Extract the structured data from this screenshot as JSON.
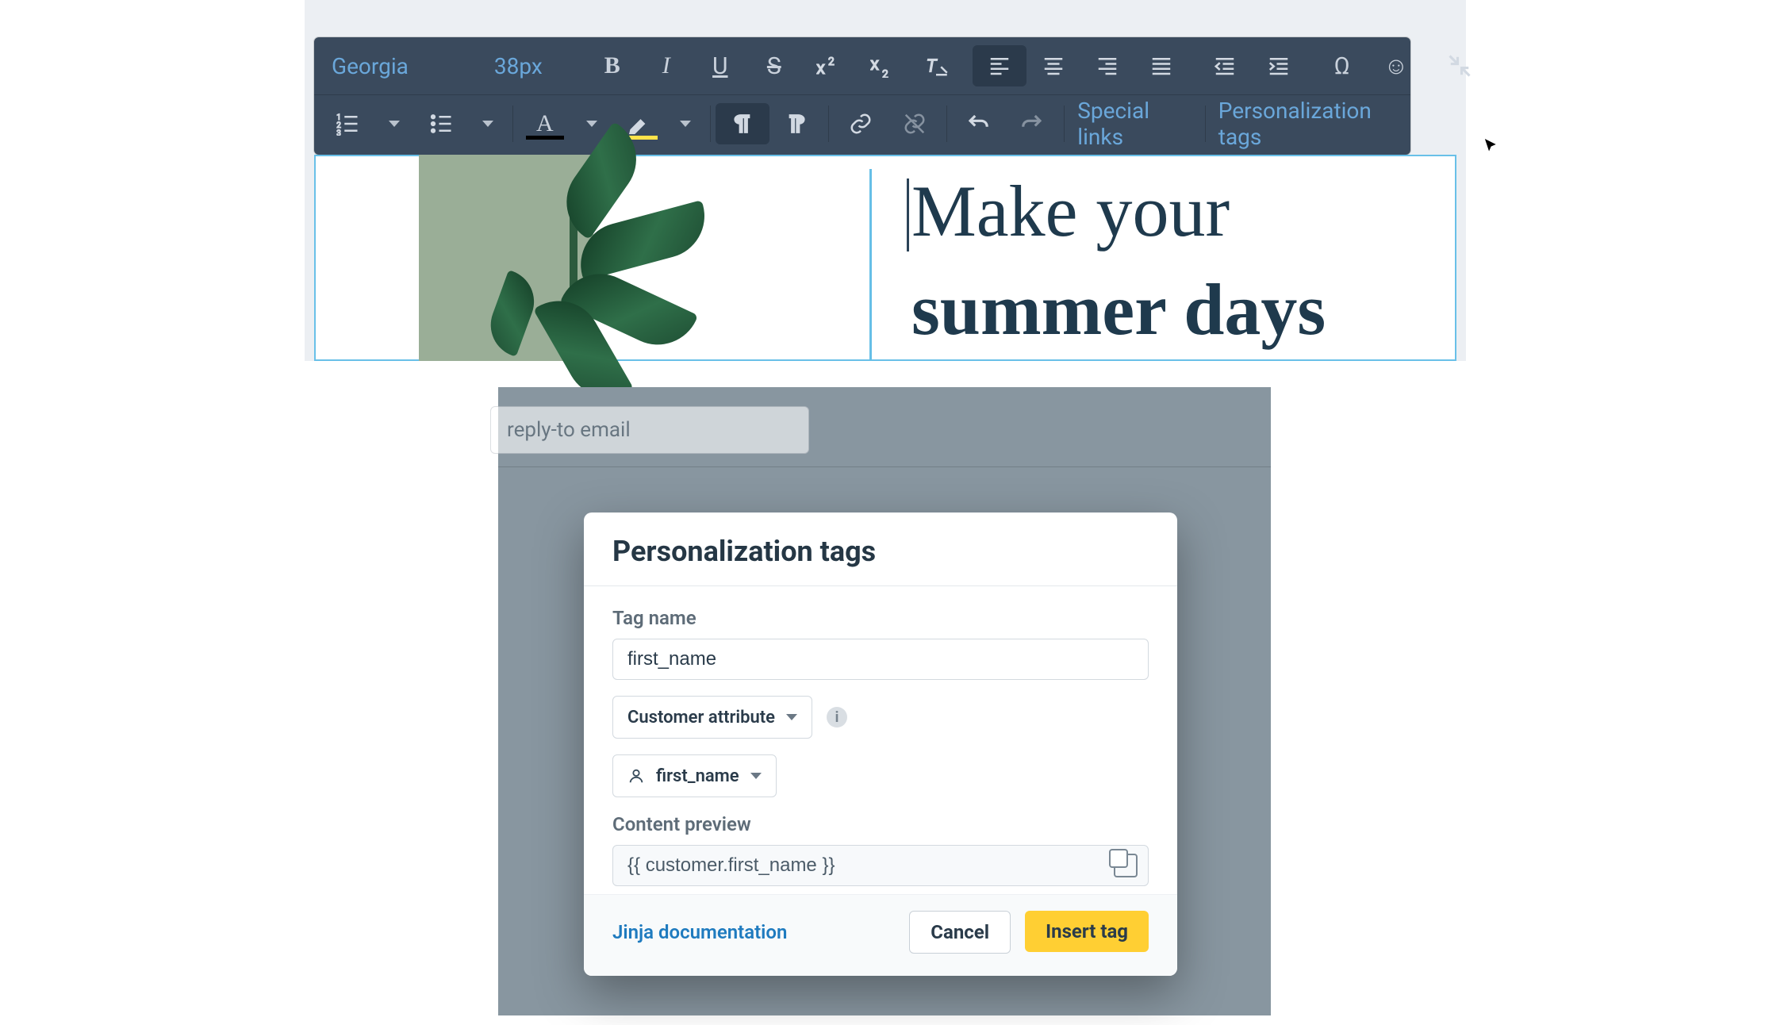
{
  "toolbar": {
    "font_family": "Georgia",
    "font_size": "38px",
    "special_links_label": "Special links",
    "personalization_tags_label": "Personalization tags"
  },
  "canvas": {
    "headline_line1": "Make your",
    "headline_line2": "summer days"
  },
  "cursor_position_desc": "mouse-pointer",
  "background_input_placeholder": "reply-to email",
  "modal": {
    "title": "Personalization tags",
    "tag_name_label": "Tag name",
    "tag_name_value": "first_name",
    "scope_select_value": "Customer attribute",
    "attribute_select_value": "first_name",
    "content_preview_label": "Content preview",
    "content_preview_value": "{{ customer.first_name }}",
    "doc_link_label": "Jinja documentation",
    "cancel_label": "Cancel",
    "insert_label": "Insert tag"
  },
  "icons": {
    "bold": "B",
    "italic": "I",
    "underline": "U",
    "strike": "S",
    "superscript": "x²",
    "subscript": "x₂",
    "omega": "Ω",
    "emoji": "☺"
  }
}
